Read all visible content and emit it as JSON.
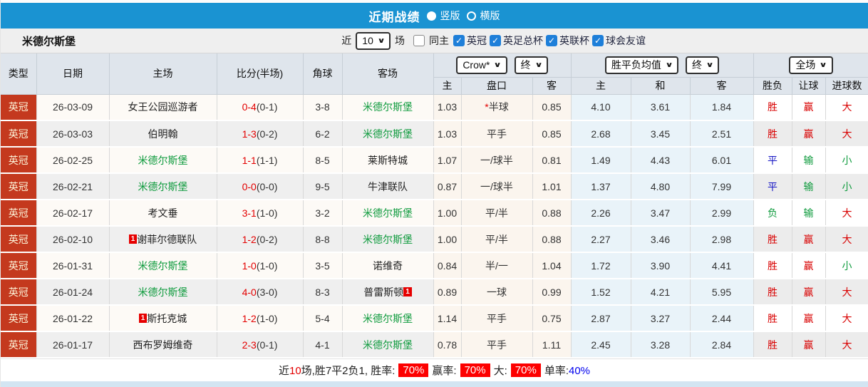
{
  "title_bar": {
    "title": "近期战绩",
    "radios": [
      {
        "label": "竖版",
        "selected": true
      },
      {
        "label": "横版",
        "selected": false
      }
    ]
  },
  "filter_bar": {
    "team": "米德尔斯堡",
    "near_label": "近",
    "matches_count": "10",
    "unit_label": "场",
    "same_home": {
      "label": "同主",
      "checked": false
    },
    "competitions": [
      {
        "label": "英冠",
        "checked": true
      },
      {
        "label": "英足总杯",
        "checked": true
      },
      {
        "label": "英联杯",
        "checked": true
      },
      {
        "label": "球会友谊",
        "checked": true
      }
    ]
  },
  "table": {
    "left_headers": [
      "类型",
      "日期",
      "主场",
      "比分(半场)",
      "角球",
      "客场"
    ],
    "dropdowns": {
      "odds_source": "Crow*",
      "odds_time": "终",
      "avg_type": "胜平负均值",
      "avg_time": "终",
      "scope": "全场"
    },
    "sub_headers": [
      "主",
      "盘口",
      "客",
      "主",
      "和",
      "客",
      "胜负",
      "让球",
      "进球数"
    ],
    "rows": [
      {
        "type": "英冠",
        "date": "26-03-09",
        "home": "女王公园巡游者",
        "home_green": false,
        "home_card": null,
        "score": "0-4",
        "half": "(0-1)",
        "corners": "3-8",
        "away": "米德尔斯堡",
        "away_green": true,
        "away_card": null,
        "crow_home": "1.03",
        "handicap_star": true,
        "handicap": "半球",
        "crow_away": "0.85",
        "avg_home": "4.10",
        "avg_draw": "3.61",
        "avg_away": "1.84",
        "outcome": {
          "text": "胜",
          "color": "red"
        },
        "handicap_outcome": {
          "text": "赢",
          "color": "red"
        },
        "goals_outcome": {
          "text": "大",
          "color": "red"
        }
      },
      {
        "type": "英冠",
        "date": "26-03-03",
        "home": "伯明翰",
        "home_green": false,
        "home_card": null,
        "score": "1-3",
        "half": "(0-2)",
        "corners": "6-2",
        "away": "米德尔斯堡",
        "away_green": true,
        "away_card": null,
        "crow_home": "1.03",
        "handicap_star": false,
        "handicap": "平手",
        "crow_away": "0.85",
        "avg_home": "2.68",
        "avg_draw": "3.45",
        "avg_away": "2.51",
        "outcome": {
          "text": "胜",
          "color": "red"
        },
        "handicap_outcome": {
          "text": "赢",
          "color": "red"
        },
        "goals_outcome": {
          "text": "大",
          "color": "red"
        }
      },
      {
        "type": "英冠",
        "date": "26-02-25",
        "home": "米德尔斯堡",
        "home_green": true,
        "home_card": null,
        "score": "1-1",
        "half": "(1-1)",
        "corners": "8-5",
        "away": "莱斯特城",
        "away_green": false,
        "away_card": null,
        "crow_home": "1.07",
        "handicap_star": false,
        "handicap": "一/球半",
        "crow_away": "0.81",
        "avg_home": "1.49",
        "avg_draw": "4.43",
        "avg_away": "6.01",
        "outcome": {
          "text": "平",
          "color": "blue"
        },
        "handicap_outcome": {
          "text": "输",
          "color": "green"
        },
        "goals_outcome": {
          "text": "小",
          "color": "green"
        }
      },
      {
        "type": "英冠",
        "date": "26-02-21",
        "home": "米德尔斯堡",
        "home_green": true,
        "home_card": null,
        "score": "0-0",
        "half": "(0-0)",
        "corners": "9-5",
        "away": "牛津联队",
        "away_green": false,
        "away_card": null,
        "crow_home": "0.87",
        "handicap_star": false,
        "handicap": "一/球半",
        "crow_away": "1.01",
        "avg_home": "1.37",
        "avg_draw": "4.80",
        "avg_away": "7.99",
        "outcome": {
          "text": "平",
          "color": "blue"
        },
        "handicap_outcome": {
          "text": "输",
          "color": "green"
        },
        "goals_outcome": {
          "text": "小",
          "color": "green"
        }
      },
      {
        "type": "英冠",
        "date": "26-02-17",
        "home": "考文垂",
        "home_green": false,
        "home_card": null,
        "score": "3-1",
        "half": "(1-0)",
        "corners": "3-2",
        "away": "米德尔斯堡",
        "away_green": true,
        "away_card": null,
        "crow_home": "1.00",
        "handicap_star": false,
        "handicap": "平/半",
        "crow_away": "0.88",
        "avg_home": "2.26",
        "avg_draw": "3.47",
        "avg_away": "2.99",
        "outcome": {
          "text": "负",
          "color": "green"
        },
        "handicap_outcome": {
          "text": "输",
          "color": "green"
        },
        "goals_outcome": {
          "text": "大",
          "color": "red"
        }
      },
      {
        "type": "英冠",
        "date": "26-02-10",
        "home": "谢菲尔德联队",
        "home_green": false,
        "home_card": {
          "text": "1",
          "pos": "before"
        },
        "score": "1-2",
        "half": "(0-2)",
        "corners": "8-8",
        "away": "米德尔斯堡",
        "away_green": true,
        "away_card": null,
        "crow_home": "1.00",
        "handicap_star": false,
        "handicap": "平/半",
        "crow_away": "0.88",
        "avg_home": "2.27",
        "avg_draw": "3.46",
        "avg_away": "2.98",
        "outcome": {
          "text": "胜",
          "color": "red"
        },
        "handicap_outcome": {
          "text": "赢",
          "color": "red"
        },
        "goals_outcome": {
          "text": "大",
          "color": "red"
        }
      },
      {
        "type": "英冠",
        "date": "26-01-31",
        "home": "米德尔斯堡",
        "home_green": true,
        "home_card": null,
        "score": "1-0",
        "half": "(1-0)",
        "corners": "3-5",
        "away": "诺维奇",
        "away_green": false,
        "away_card": null,
        "crow_home": "0.84",
        "handicap_star": false,
        "handicap": "半/一",
        "crow_away": "1.04",
        "avg_home": "1.72",
        "avg_draw": "3.90",
        "avg_away": "4.41",
        "outcome": {
          "text": "胜",
          "color": "red"
        },
        "handicap_outcome": {
          "text": "赢",
          "color": "red"
        },
        "goals_outcome": {
          "text": "小",
          "color": "green"
        }
      },
      {
        "type": "英冠",
        "date": "26-01-24",
        "home": "米德尔斯堡",
        "home_green": true,
        "home_card": null,
        "score": "4-0",
        "half": "(3-0)",
        "corners": "8-3",
        "away": "普雷斯顿",
        "away_green": false,
        "away_card": {
          "text": "1",
          "pos": "after"
        },
        "crow_home": "0.89",
        "handicap_star": false,
        "handicap": "一球",
        "crow_away": "0.99",
        "avg_home": "1.52",
        "avg_draw": "4.21",
        "avg_away": "5.95",
        "outcome": {
          "text": "胜",
          "color": "red"
        },
        "handicap_outcome": {
          "text": "赢",
          "color": "red"
        },
        "goals_outcome": {
          "text": "大",
          "color": "red"
        }
      },
      {
        "type": "英冠",
        "date": "26-01-22",
        "home": "斯托克城",
        "home_green": false,
        "home_card": {
          "text": "1",
          "pos": "before"
        },
        "score": "1-2",
        "half": "(1-0)",
        "corners": "5-4",
        "away": "米德尔斯堡",
        "away_green": true,
        "away_card": null,
        "crow_home": "1.14",
        "handicap_star": false,
        "handicap": "平手",
        "crow_away": "0.75",
        "avg_home": "2.87",
        "avg_draw": "3.27",
        "avg_away": "2.44",
        "outcome": {
          "text": "胜",
          "color": "red"
        },
        "handicap_outcome": {
          "text": "赢",
          "color": "red"
        },
        "goals_outcome": {
          "text": "大",
          "color": "red"
        }
      },
      {
        "type": "英冠",
        "date": "26-01-17",
        "home": "西布罗姆维奇",
        "home_green": false,
        "home_card": null,
        "score": "2-3",
        "half": "(0-1)",
        "corners": "4-1",
        "away": "米德尔斯堡",
        "away_green": true,
        "away_card": null,
        "crow_home": "0.78",
        "handicap_star": false,
        "handicap": "平手",
        "crow_away": "1.11",
        "avg_home": "2.45",
        "avg_draw": "3.28",
        "avg_away": "2.84",
        "outcome": {
          "text": "胜",
          "color": "red"
        },
        "handicap_outcome": {
          "text": "赢",
          "color": "red"
        },
        "goals_outcome": {
          "text": "大",
          "color": "red"
        }
      }
    ]
  },
  "footer": {
    "prefix": "近",
    "count": "10",
    "summary": "场,胜7平2负1, 胜率:",
    "rate1": "70%",
    "label2": "赢率:",
    "rate2": "70%",
    "label3": "大:",
    "rate3": "70%",
    "label4": "单率:",
    "rate4": "40%"
  }
}
